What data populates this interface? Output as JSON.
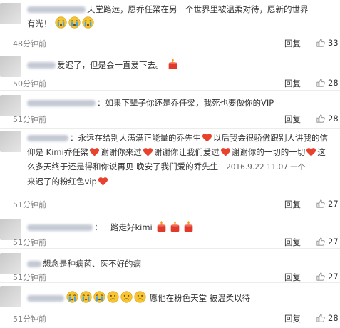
{
  "comments": [
    {
      "username": "",
      "text_line1": "天堂路远，愿乔任梁在另一个世界里被温柔对待，愿新的世界",
      "text_line2": "有光！",
      "emojis": [
        "crying-face",
        "crying-face",
        "crying-face"
      ],
      "time": "48分钟前",
      "reply": "回复",
      "likes": "33"
    },
    {
      "username": "",
      "text": "爱迟了，但是会一直爱下去。",
      "emojis": [
        "candle"
      ],
      "time": "50分钟前",
      "reply": "回复",
      "likes": "28"
    },
    {
      "username": "",
      "text": "：如果下辈子你还是乔任梁，我死也要做你的VIP",
      "time": "51分钟前",
      "reply": "回复",
      "likes": "28"
    },
    {
      "username": "",
      "seg1": "：永远在给别人满满正能量的乔先生",
      "seg2": "以后我会很骄傲跟别人讲我的信",
      "seg3": "仰是 Kimi乔任梁",
      "seg4": "谢谢你来过",
      "seg5": "谢谢你让我们爱过",
      "seg6": "谢谢你的一切的一切",
      "seg7": "这",
      "seg8": "么多天终于还是得和你说再见 晚安了我们爱的乔先生",
      "seg9": "2016.9.22 11.07 一个",
      "seg10": "来迟了的粉红色vip",
      "time": "51分钟前",
      "reply": "回复",
      "likes": "27"
    },
    {
      "username": "",
      "text": "：一路走好kimi",
      "emojis": [
        "candle",
        "candle",
        "candle"
      ],
      "time": "51分钟前",
      "reply": "回复",
      "likes": "27"
    },
    {
      "username": "",
      "text": "想念是种病菌、医不好的病",
      "time": "51分钟前",
      "reply": "回复",
      "likes": "27"
    },
    {
      "username": "",
      "text": "愿他在粉色天堂 被温柔以待",
      "emojis": [
        "crying-face",
        "crying-face",
        "crying-face",
        "sad-face",
        "sad-face",
        "sad-face"
      ],
      "time": "51分钟前",
      "reply": "回复",
      "likes": "28"
    }
  ],
  "colors": {
    "time": "#808080",
    "heart": "#e8412c",
    "emoji_face": "#f7c531",
    "separator": "#ececec"
  }
}
